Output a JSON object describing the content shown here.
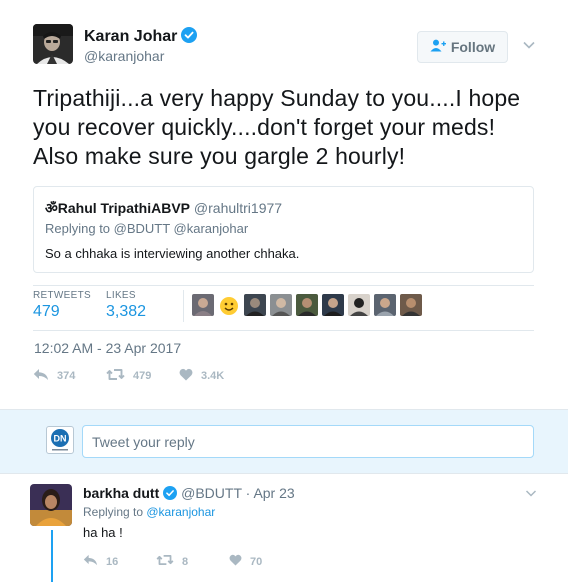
{
  "tweet": {
    "author_name": "Karan Johar",
    "author_handle": "@karanjohar",
    "verified": true,
    "follow_label": "Follow",
    "text": "Tripathiji...a very happy Sunday to you....I hope you recover quickly....don't forget your meds! Also make sure you gargle 2 hourly!",
    "quoted": {
      "author_name": "ॐRahul TripathiABVP",
      "author_handle": "@rahultri1977",
      "replying_to": "Replying to @BDUTT @karanjohar",
      "text": "So a chhaka is interviewing another chhaka."
    },
    "stats": {
      "retweets_label": "RETWEETS",
      "retweets": "479",
      "likes_label": "LIKES",
      "likes": "3,382"
    },
    "timestamp": "12:02 AM - 23 Apr 2017",
    "actions": {
      "replies": "374",
      "retweets": "479",
      "likes": "3.4K"
    }
  },
  "reply_box": {
    "logo_text": "DN",
    "placeholder": "Tweet your reply"
  },
  "reply": {
    "author_name": "barkha dutt",
    "author_handle": "@BDUTT",
    "date": "Apr 23",
    "verified": true,
    "replying_prefix": "Replying to ",
    "replying_to": "@karanjohar",
    "text": "ha ha !",
    "actions": {
      "replies": "16",
      "retweets": "8",
      "likes": "70"
    }
  },
  "colors": {
    "link": "#1b95e0",
    "verified": "#1da1f2",
    "muted": "#657786",
    "action": "#aab8c2",
    "reply_bg": "#e8f5fd"
  },
  "icons": {
    "verified": "verified-badge-icon",
    "follow": "add-user-icon",
    "caret": "chevron-down-icon",
    "reply": "reply-icon",
    "retweet": "retweet-icon",
    "like": "heart-icon"
  }
}
